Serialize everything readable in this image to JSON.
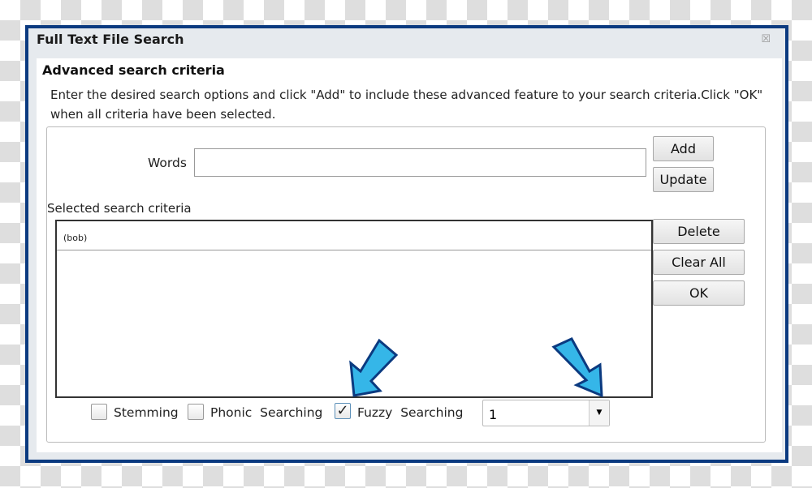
{
  "window": {
    "title": "Full Text File Search",
    "close_icon": "close-icon"
  },
  "section": {
    "heading": "Advanced search criteria",
    "description": "Enter the desired search options and click  \"Add\" to include these advanced feature to your search criteria.Click \"OK\" when all criteria have been selected."
  },
  "words": {
    "label": "Words",
    "value": ""
  },
  "buttons": {
    "add": "Add",
    "update": "Update",
    "delete": "Delete",
    "clear_all": "Clear All",
    "ok": "OK"
  },
  "criteria": {
    "label": "Selected search criteria",
    "items": [
      "(bob)"
    ]
  },
  "options": {
    "stemming": {
      "label": "Stemming",
      "checked": false
    },
    "phonic": {
      "label": "Phonic  Searching",
      "checked": false
    },
    "fuzzy": {
      "label": "Fuzzy  Searching",
      "checked": true,
      "mark": "✓"
    },
    "fuzzy_level": "1"
  },
  "colors": {
    "frame": "#0b3a80",
    "arrow_fill": "#35b6e8",
    "arrow_stroke": "#0b3a80"
  }
}
